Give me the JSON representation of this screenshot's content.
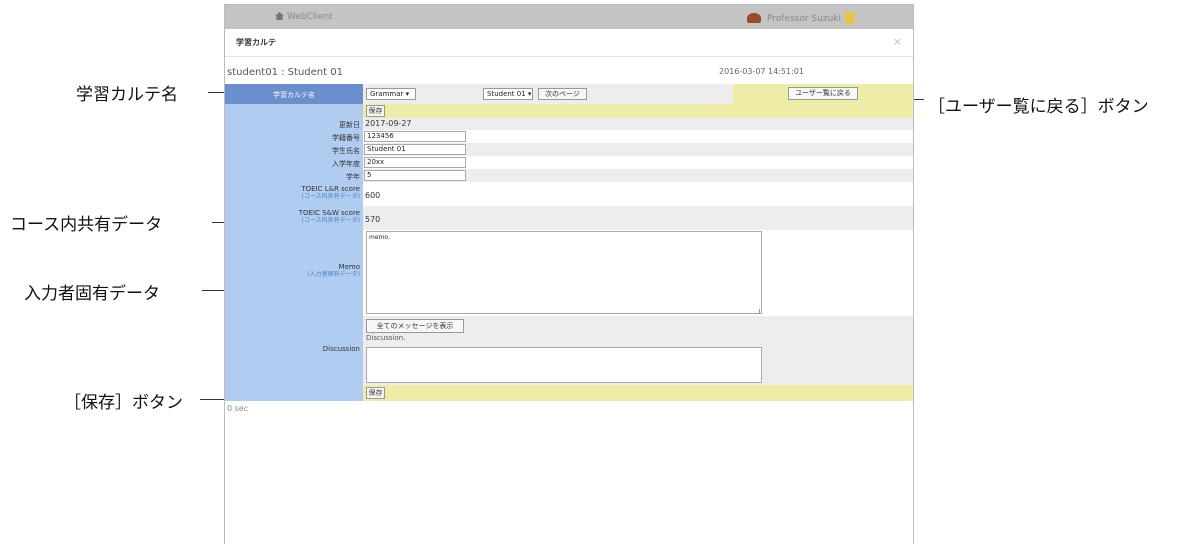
{
  "topbar": {
    "app_name": "WebClient",
    "user_name": "Professor Suzuki"
  },
  "dialog": {
    "title": "学習カルテ",
    "close": "×"
  },
  "record": {
    "name": "student01 : Student 01",
    "datetime": "2016-03-07 14:51:01"
  },
  "header": {
    "label": "学習カルテ名",
    "karte_select": "Grammar ▾",
    "student_select": "Student 01 ▾",
    "next_page": "次のページ",
    "back_button": "ユーザー覧に戻る"
  },
  "save_label": "保存",
  "fields": {
    "updated_label": "更新日",
    "updated_value": "2017-09-27",
    "student_no_label": "学籍番号",
    "student_no_value": "123456",
    "student_name_label": "学生氏名",
    "student_name_value": "Student 01",
    "enroll_year_label": "入学年度",
    "enroll_year_value": "20xx",
    "grade_label": "学年",
    "grade_value": "5",
    "toeic_lr_label": "TOEIC L&R score",
    "toeic_lr_sub": "(コース内共有データ)",
    "toeic_lr_value": "600",
    "toeic_sw_label": "TOEIC S&W score",
    "toeic_sw_sub": "(コース内共有データ)",
    "toeic_sw_value": "570",
    "memo_label": "Memo",
    "memo_sub": "(入力者固有データ)",
    "memo_value": "memo.",
    "show_all_button": "全てのメッセージを表示",
    "discussion_label": "Discussion",
    "discussion_text": "Discussion."
  },
  "footer_text": "0 sec",
  "callouts": {
    "karte_name": "学習カルテ名",
    "back_button": "［ユーザー覧に戻る］ボタン",
    "course_shared": "コース内共有データ",
    "user_specific": "入力者固有データ",
    "save_button": "［保存］ボタン"
  }
}
